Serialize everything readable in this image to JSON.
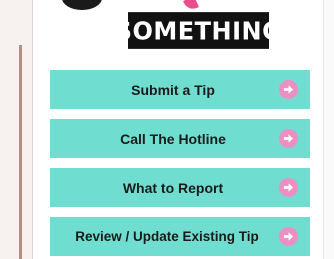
{
  "logo": {
    "text": "SOMETHING"
  },
  "menu": {
    "items": [
      {
        "label": "Submit a Tip"
      },
      {
        "label": "Call The Hotline"
      },
      {
        "label": "What to Report"
      },
      {
        "label": "Review / Update Existing Tip"
      }
    ],
    "button_color": "#6fded0",
    "arrow_color": "#ee8fc4"
  }
}
